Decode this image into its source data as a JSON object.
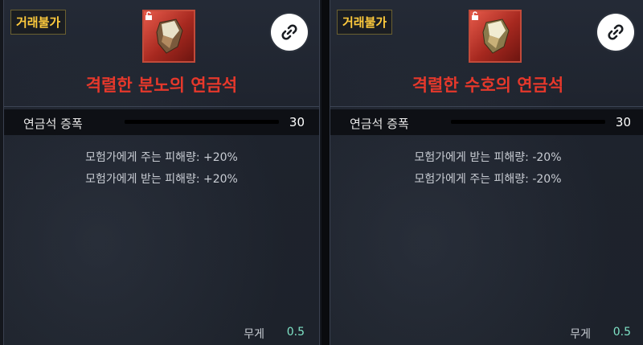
{
  "panels": [
    {
      "badge": "거래불가",
      "item_icon": "alchemy-stone-rage-icon",
      "title": "격렬한 분노의 연금석",
      "stat": {
        "label": "연금석 증폭",
        "value": "30"
      },
      "effects": [
        "모험가에게 주는 피해량: +20%",
        "모험가에게 받는 피해량: +20%"
      ],
      "weight": {
        "label": "무게",
        "value": "0.5"
      }
    },
    {
      "badge": "거래불가",
      "item_icon": "alchemy-stone-guard-icon",
      "title": "격렬한 수호의 연금석",
      "stat": {
        "label": "연금석 증폭",
        "value": "30"
      },
      "effects": [
        "모험가에게 받는 피해량: -20%",
        "모험가에게 주는 피해량: -20%"
      ],
      "weight": {
        "label": "무게",
        "value": "0.5"
      }
    }
  ],
  "colors": {
    "badge": "#ffcb3d",
    "title": "#e6382b",
    "weight_value": "#7fe3c6",
    "icon_frame": "#c24a3a"
  }
}
